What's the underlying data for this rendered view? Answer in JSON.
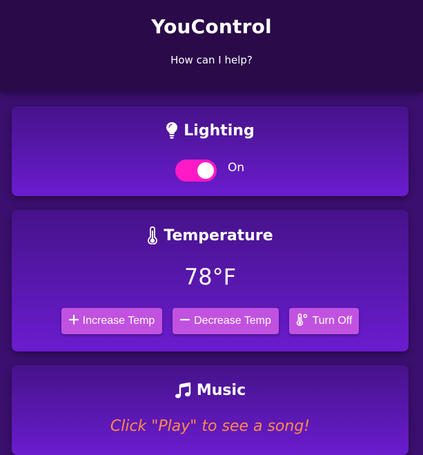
{
  "header": {
    "title": "YouControl",
    "subtitle": "How can I help?"
  },
  "lighting": {
    "title": "Lighting",
    "icon": "lightbulb-icon",
    "toggle_state": "On",
    "toggle_on": true,
    "toggle_color": "#ff1ac6"
  },
  "temperature": {
    "title": "Temperature",
    "icon": "thermometer-icon",
    "value": "78°F",
    "buttons": {
      "increase": "Increase Temp",
      "decrease": "Decrease Temp",
      "off": "Turn Off"
    },
    "button_color": "#c152e0"
  },
  "music": {
    "title": "Music",
    "icon": "music-note-icon",
    "prompt": "Click \"Play\" to see a song!",
    "prompt_color": "#ff8a4a"
  }
}
